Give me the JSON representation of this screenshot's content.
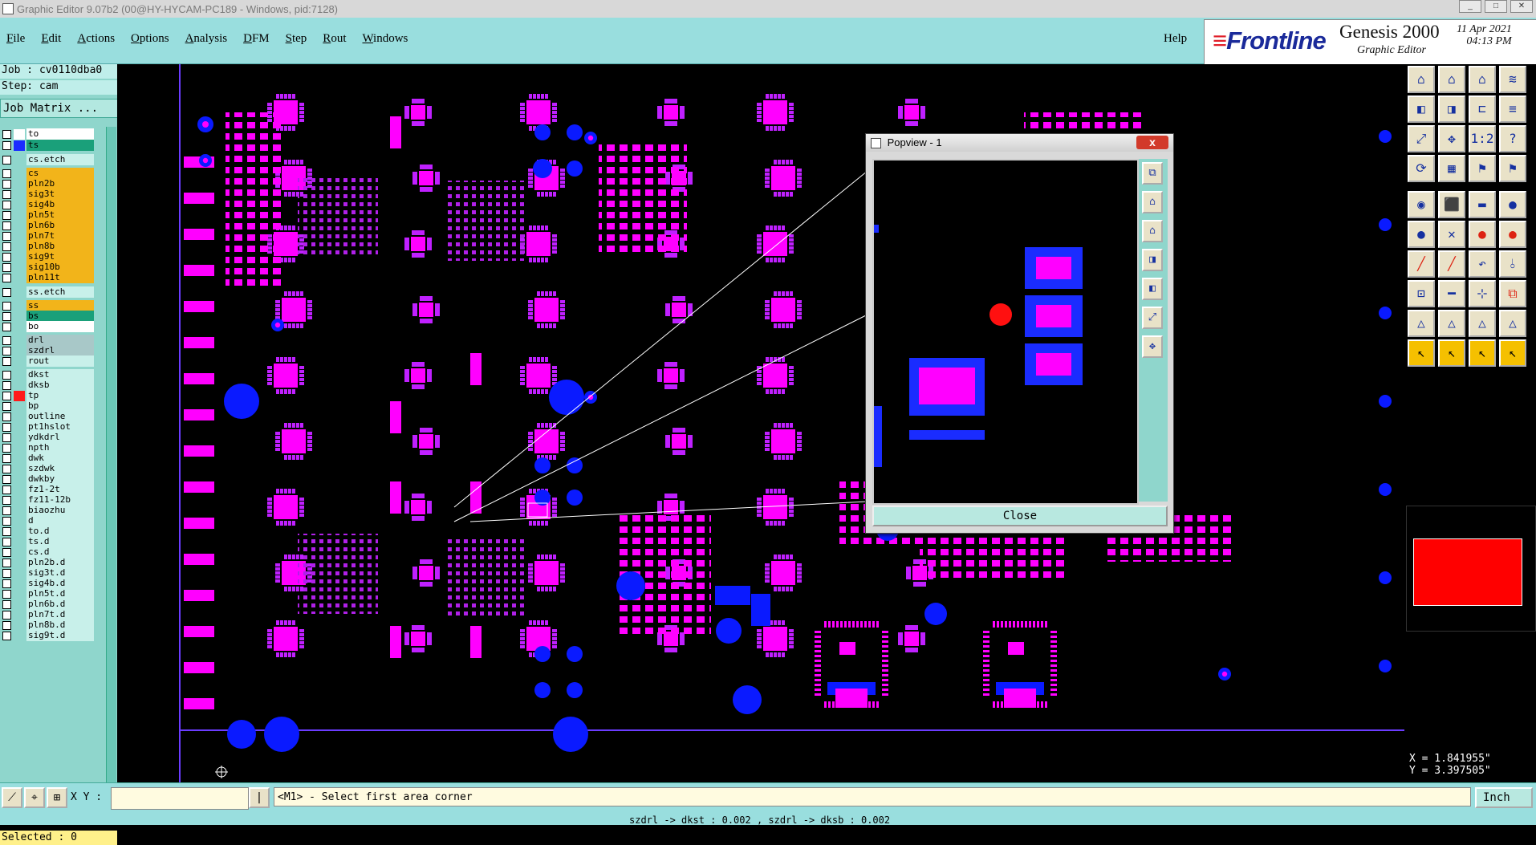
{
  "window": {
    "title": "Graphic Editor 9.07b2 (00@HY-HYCAM-PC189 - Windows, pid:7128)"
  },
  "menu": {
    "items": [
      "File",
      "Edit",
      "Actions",
      "Options",
      "Analysis",
      "DFM",
      "Step",
      "Rout",
      "Windows"
    ],
    "help": "Help"
  },
  "brand": {
    "logo": "Frontline",
    "product": "Genesis 2000",
    "subtitle": "Graphic Editor",
    "date": "11 Apr 2021",
    "time": "04:13 PM"
  },
  "job": {
    "job_line": "Job : cv0110dba0",
    "step_line": "Step: cam",
    "matrix_button": "Job Matrix ..."
  },
  "layers": [
    {
      "name": "to",
      "swatch": "#ffffff",
      "bg": "#ffffff"
    },
    {
      "name": "ts",
      "swatch": "#1a2cff",
      "bg": "#1aa07a"
    },
    {
      "name": "cs.etch",
      "swatch": "",
      "bg": "#c8f0ea"
    },
    {
      "name": "cs",
      "swatch": "",
      "bg": "#f2b41a"
    },
    {
      "name": "pln2b",
      "swatch": "",
      "bg": "#f2b41a"
    },
    {
      "name": "sig3t",
      "swatch": "",
      "bg": "#f2b41a"
    },
    {
      "name": "sig4b",
      "swatch": "",
      "bg": "#f2b41a"
    },
    {
      "name": "pln5t",
      "swatch": "",
      "bg": "#f2b41a"
    },
    {
      "name": "pln6b",
      "swatch": "",
      "bg": "#f2b41a"
    },
    {
      "name": "pln7t",
      "swatch": "",
      "bg": "#f2b41a"
    },
    {
      "name": "pln8b",
      "swatch": "",
      "bg": "#f2b41a"
    },
    {
      "name": "sig9t",
      "swatch": "",
      "bg": "#f2b41a"
    },
    {
      "name": "sig10b",
      "swatch": "",
      "bg": "#f2b41a"
    },
    {
      "name": "pln11t",
      "swatch": "",
      "bg": "#f2b41a"
    },
    {
      "name": "ss.etch",
      "swatch": "",
      "bg": "#c8f0ea"
    },
    {
      "name": "ss",
      "swatch": "",
      "bg": "#f2b41a"
    },
    {
      "name": "bs",
      "swatch": "",
      "bg": "#1aa07a"
    },
    {
      "name": "bo",
      "swatch": "",
      "bg": "#ffffff"
    },
    {
      "name": "drl",
      "swatch": "",
      "bg": "#a8c8c8"
    },
    {
      "name": "szdrl",
      "swatch": "",
      "bg": "#a8c8c8"
    },
    {
      "name": "rout",
      "swatch": "",
      "bg": "#c8f0ea"
    },
    {
      "name": "dkst",
      "swatch": "",
      "bg": "#c8f0ea"
    },
    {
      "name": "dksb",
      "swatch": "",
      "bg": "#c8f0ea"
    },
    {
      "name": "tp",
      "swatch": "#ff1a1a",
      "bg": "#c8f0ea"
    },
    {
      "name": "bp",
      "swatch": "",
      "bg": "#c8f0ea"
    },
    {
      "name": "outline",
      "swatch": "",
      "bg": "#c8f0ea"
    },
    {
      "name": "pt1hslot",
      "swatch": "",
      "bg": "#c8f0ea"
    },
    {
      "name": "ydkdrl",
      "swatch": "",
      "bg": "#c8f0ea"
    },
    {
      "name": "npth",
      "swatch": "",
      "bg": "#c8f0ea"
    },
    {
      "name": "dwk",
      "swatch": "",
      "bg": "#c8f0ea"
    },
    {
      "name": "szdwk",
      "swatch": "",
      "bg": "#c8f0ea"
    },
    {
      "name": "dwkby",
      "swatch": "",
      "bg": "#c8f0ea"
    },
    {
      "name": "fz1-2t",
      "swatch": "",
      "bg": "#c8f0ea"
    },
    {
      "name": "fz11-12b",
      "swatch": "",
      "bg": "#c8f0ea"
    },
    {
      "name": "biaozhu",
      "swatch": "",
      "bg": "#c8f0ea"
    },
    {
      "name": "d",
      "swatch": "",
      "bg": "#c8f0ea"
    },
    {
      "name": "to.d",
      "swatch": "",
      "bg": "#c8f0ea"
    },
    {
      "name": "ts.d",
      "swatch": "",
      "bg": "#c8f0ea"
    },
    {
      "name": "cs.d",
      "swatch": "",
      "bg": "#c8f0ea"
    },
    {
      "name": "pln2b.d",
      "swatch": "",
      "bg": "#c8f0ea"
    },
    {
      "name": "sig3t.d",
      "swatch": "",
      "bg": "#c8f0ea"
    },
    {
      "name": "sig4b.d",
      "swatch": "",
      "bg": "#c8f0ea"
    },
    {
      "name": "pln5t.d",
      "swatch": "",
      "bg": "#c8f0ea"
    },
    {
      "name": "pln6b.d",
      "swatch": "",
      "bg": "#c8f0ea"
    },
    {
      "name": "pln7t.d",
      "swatch": "",
      "bg": "#c8f0ea"
    },
    {
      "name": "pln8b.d",
      "swatch": "",
      "bg": "#c8f0ea"
    },
    {
      "name": "sig9t.d",
      "swatch": "",
      "bg": "#c8f0ea"
    }
  ],
  "selected": "Selected : 0",
  "popview": {
    "title": "Popview - 1",
    "close_x": "x",
    "close_button": "Close"
  },
  "coords": {
    "x": "X = 1.841955\"",
    "y": "Y = 3.397505\""
  },
  "status": {
    "xy_label": "X Y :",
    "xy_value": "",
    "prompt": "<M1> - Select first area corner",
    "unit": "Inch",
    "bottom": "szdrl -> dkst : 0.002 , szdrl -> dksb : 0.002"
  },
  "colors": {
    "pad": "#ff00ff",
    "via": "#0a1aff",
    "panel": "#99dede"
  }
}
